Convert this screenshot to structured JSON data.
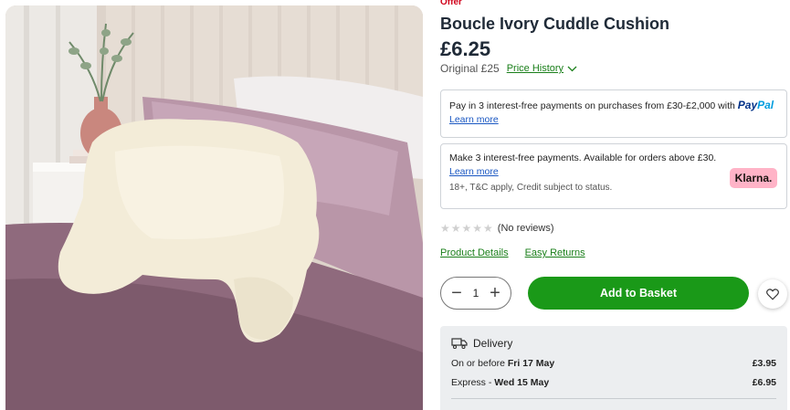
{
  "product": {
    "offer_label": "Offer",
    "title": "Boucle Ivory Cuddle Cushion",
    "price": "£6.25",
    "original_price": "Original £25",
    "price_history_label": "Price History"
  },
  "paypal": {
    "text": "Pay in 3 interest-free payments on purchases from £30-£2,000 with",
    "logo_pay": "Pay",
    "logo_pal": "Pal",
    "learn_more": "Learn more"
  },
  "klarna": {
    "text": "Make 3 interest-free payments. Available for orders above £30.",
    "learn_more": "Learn more",
    "note": "18+, T&C apply, Credit subject to status.",
    "badge": "Klarna."
  },
  "reviews": {
    "rating": 0,
    "stars": "★★★★★",
    "label": "(No reviews)"
  },
  "links": {
    "product_details": "Product Details",
    "easy_returns": "Easy Returns"
  },
  "basket": {
    "minus": "−",
    "quantity": "1",
    "plus": "+",
    "add_label": "Add to Basket"
  },
  "delivery": {
    "heading": "Delivery",
    "options": [
      {
        "prefix": "On or before ",
        "date": "Fri 17 May",
        "price": "£3.95"
      },
      {
        "prefix": "Express - ",
        "date": "Wed 15 May",
        "price": "£6.95"
      }
    ]
  },
  "colors": {
    "accent_green": "#1a9918",
    "link_green": "#1a7f1a",
    "offer_red": "#d0021b",
    "klarna_pink": "#ffb3c7"
  },
  "icons": [
    "chevron-down-icon",
    "heart-icon",
    "truck-icon",
    "star-icon"
  ]
}
